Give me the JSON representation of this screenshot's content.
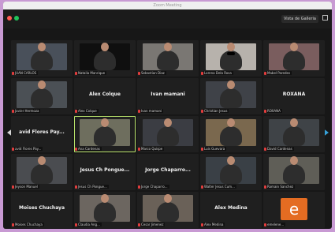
{
  "window": {
    "title": "Zoom Meeting",
    "gallery_view": "Vista de Galleria"
  },
  "colors": {
    "accent_active": "#b8e36b",
    "mic_muted": "#e23d3d",
    "nav_right": "#37a1d8",
    "avatar_orange": "#e46c22"
  },
  "participants": [
    {
      "name": "JUAN CARLOS",
      "label": "",
      "bg": "#49505a",
      "muted": true
    },
    {
      "name": "Natalia Manrique",
      "label": "",
      "bg": "#0f0f0f",
      "muted": true
    },
    {
      "name": "Sebastian Diaz",
      "label": "",
      "bg": "#7a7773",
      "muted": true
    },
    {
      "name": "Lorena Dela Rosa",
      "label": "",
      "bg": "#b7b2ac",
      "muted": true
    },
    {
      "name": "Mabel Paredes",
      "label": "",
      "bg": "#7a5d5e",
      "muted": true
    },
    {
      "name": "Javier Hermoza",
      "label": "",
      "bg": "#4b5055",
      "muted": true
    },
    {
      "name": "Alex Colque",
      "label": "Alex Colque",
      "bg": "#1f1f1f",
      "muted": true
    },
    {
      "name": "Ivan mamani",
      "label": "Ivan mamani",
      "bg": "#1f1f1f",
      "muted": true
    },
    {
      "name": "Christian Jesus",
      "label": "",
      "bg": "#3f4248",
      "muted": true
    },
    {
      "name": "ROXANA",
      "label": "ROXANA",
      "bg": "#1f1f1f",
      "muted": true
    },
    {
      "name": "avid Flores Pay...",
      "label": "avid Flores Pay...",
      "bg": "#1f1f1f",
      "muted": true
    },
    {
      "name": "Ana Cardenas",
      "label": "",
      "bg": "#6e6e5e",
      "muted": true,
      "active": true
    },
    {
      "name": "Marco Quispe",
      "label": "",
      "bg": "#3b3d43",
      "muted": true
    },
    {
      "name": "Luis Guevara",
      "label": "",
      "bg": "#7a684e",
      "muted": true
    },
    {
      "name": "David Cardenas",
      "label": "",
      "bg": "#3f4347",
      "muted": true
    },
    {
      "name": "Jeyson Manuel",
      "label": "",
      "bg": "#4a4c50",
      "muted": true
    },
    {
      "name": "Jesus Ch Pongue...",
      "label": "Jesus Ch Pongue...",
      "bg": "#1f1f1f",
      "muted": true
    },
    {
      "name": "Jorge Chaparro...",
      "label": "Jorge Chaparro...",
      "bg": "#1f1f1f",
      "muted": true
    },
    {
      "name": "Walter Jesus Cum...",
      "label": "",
      "bg": "#3a4046",
      "muted": true
    },
    {
      "name": "Romain Sanchez",
      "label": "",
      "bg": "#5f5e57",
      "muted": true
    },
    {
      "name": "Moises Chuchaya",
      "label": "Moises Chuchaya",
      "bg": "#1f1f1f",
      "muted": true
    },
    {
      "name": "Claudia Ang...",
      "label": "",
      "bg": "#6c6660",
      "muted": true
    },
    {
      "name": "Cesar Jimenez",
      "label": "",
      "bg": "#6a6158",
      "muted": true
    },
    {
      "name": "Alex Medina",
      "label": "Alex Medina",
      "bg": "#1f1f1f",
      "muted": true
    },
    {
      "name": "emelene...",
      "label": "",
      "bg": "#1f1f1f",
      "muted": true,
      "avatar": "e"
    }
  ]
}
